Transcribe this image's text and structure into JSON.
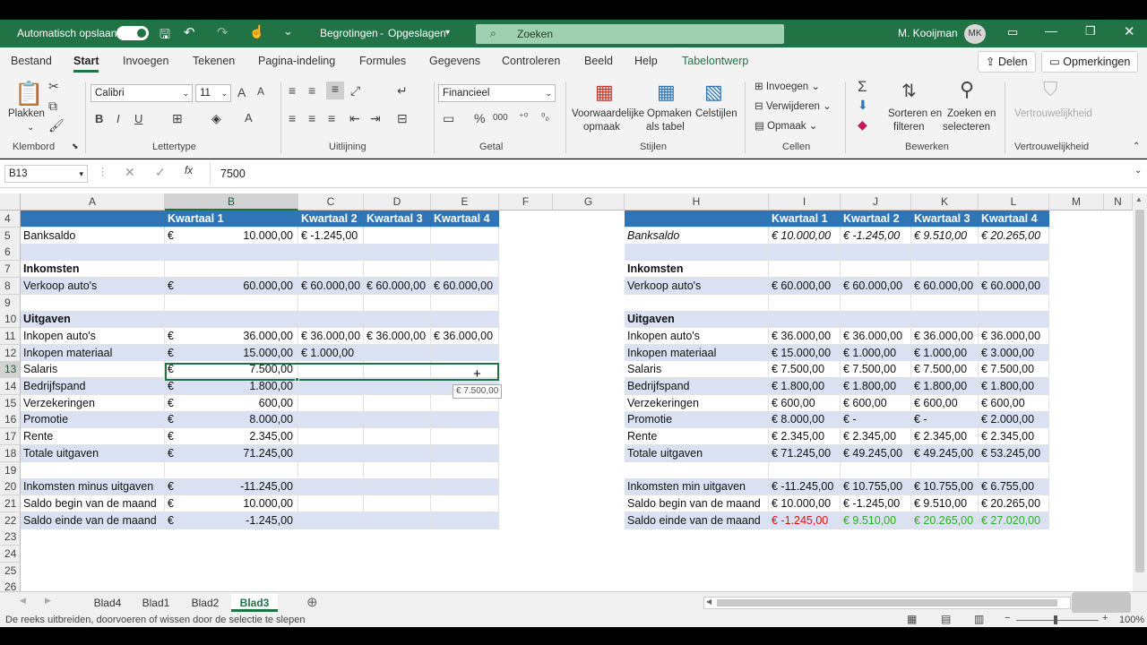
{
  "titlebar": {
    "autosave_label": "Automatisch opslaan",
    "doc_title": "Begrotingen",
    "doc_status": "Opgeslagen",
    "search_placeholder": "Zoeken",
    "user_name": "M. Kooijman",
    "user_initials": "MK"
  },
  "ribbon_tabs": [
    "Bestand",
    "Start",
    "Invoegen",
    "Tekenen",
    "Pagina-indeling",
    "Formules",
    "Gegevens",
    "Controleren",
    "Beeld",
    "Help",
    "Tabelontwerp"
  ],
  "share_label": "Delen",
  "comments_label": "Opmerkingen",
  "ribbon": {
    "paste": "Plakken",
    "clipboard": "Klembord",
    "font_name": "Calibri",
    "font_size": "11",
    "font_group": "Lettertype",
    "align_group": "Uitlijning",
    "number_format": "Financieel",
    "number_group": "Getal",
    "cond_fmt_1": "Voorwaardelijke",
    "cond_fmt_2": "opmaak",
    "fmt_table_1": "Opmaken",
    "fmt_table_2": "als tabel",
    "cell_styles": "Celstijlen",
    "styles_group": "Stijlen",
    "insert": "Invoegen",
    "delete": "Verwijderen",
    "format": "Opmaak",
    "cells_group": "Cellen",
    "sort_1": "Sorteren en",
    "sort_2": "filteren",
    "find_1": "Zoeken en",
    "find_2": "selecteren",
    "edit_group": "Bewerken",
    "sens": "Vertrouwelijkheid",
    "sens_group": "Vertrouwelijkheid"
  },
  "formula_bar": {
    "name_box": "B13",
    "fx": "fx",
    "value": "7500"
  },
  "columns": [
    "A",
    "B",
    "C",
    "D",
    "E",
    "F",
    "G",
    "H",
    "I",
    "J",
    "K",
    "L",
    "M",
    "N"
  ],
  "rows": [
    "4",
    "5",
    "6",
    "7",
    "8",
    "9",
    "10",
    "11",
    "12",
    "13",
    "14",
    "15",
    "16",
    "17",
    "18",
    "19",
    "20",
    "21",
    "22",
    "23",
    "24",
    "25",
    "26"
  ],
  "left": {
    "headers": [
      "Kwartaal 1",
      "Kwartaal 2",
      "Kwartaal 3",
      "Kwartaal 4"
    ],
    "banksaldo": {
      "label": "Banksaldo",
      "b": "10.000,00",
      "c": "€ -1.245,00"
    },
    "inkomsten": "Inkomsten",
    "verkoop": {
      "label": "Verkoop auto's",
      "b": "60.000,00",
      "c": "€ 60.000,00",
      "d": "€ 60.000,00",
      "e": "€ 60.000,00"
    },
    "uitgaven": "Uitgaven",
    "items": [
      {
        "label": "Inkopen auto's",
        "b": "36.000,00",
        "c": "€ 36.000,00",
        "d": "€ 36.000,00",
        "e": "€ 36.000,00"
      },
      {
        "label": "Inkopen materiaal",
        "b": "15.000,00",
        "c": "€  1.000,00",
        "d": "",
        "e": ""
      },
      {
        "label": "Salaris",
        "b": "7.500,00",
        "c": "",
        "d": "",
        "e": ""
      },
      {
        "label": "Bedrijfspand",
        "b": "1.800,00",
        "c": "",
        "d": "",
        "e": ""
      },
      {
        "label": "Verzekeringen",
        "b": "600,00",
        "c": "",
        "d": "",
        "e": ""
      },
      {
        "label": "Promotie",
        "b": "8.000,00",
        "c": "",
        "d": "",
        "e": ""
      },
      {
        "label": "Rente",
        "b": "2.345,00",
        "c": "",
        "d": "",
        "e": ""
      },
      {
        "label": "Totale uitgaven",
        "b": "71.245,00",
        "c": "",
        "d": "",
        "e": ""
      }
    ],
    "summary": [
      {
        "label": "Inkomsten minus uitgaven",
        "b": "-11.245,00"
      },
      {
        "label": "Saldo begin van de maand",
        "b": "10.000,00"
      },
      {
        "label": "Saldo einde van de maand",
        "b": "-1.245,00"
      }
    ],
    "euro": "€",
    "tooltip": "€ 7.500,00"
  },
  "right": {
    "headers": [
      "Kwartaal 1",
      "Kwartaal 2",
      "Kwartaal 3",
      "Kwartaal 4"
    ],
    "banksaldo": {
      "label": "Banksaldo",
      "v": [
        "€  10.000,00",
        "€  -1.245,00",
        "€  9.510,00",
        "€  20.265,00"
      ]
    },
    "inkomsten": "Inkomsten",
    "verkoop": {
      "label": "Verkoop auto's",
      "v": [
        "€  60.000,00",
        "€  60.000,00",
        "€ 60.000,00",
        "€  60.000,00"
      ]
    },
    "uitgaven": "Uitgaven",
    "items": [
      {
        "label": "Inkopen auto's",
        "v": [
          "€  36.000,00",
          "€  36.000,00",
          "€ 36.000,00",
          "€  36.000,00"
        ]
      },
      {
        "label": "Inkopen materiaal",
        "v": [
          "€  15.000,00",
          "€     1.000,00",
          "€  1.000,00",
          "€    3.000,00"
        ]
      },
      {
        "label": "Salaris",
        "v": [
          "€    7.500,00",
          "€     7.500,00",
          "€  7.500,00",
          "€    7.500,00"
        ]
      },
      {
        "label": "Bedrijfspand",
        "v": [
          "€    1.800,00",
          "€     1.800,00",
          "€  1.800,00",
          "€    1.800,00"
        ]
      },
      {
        "label": "Verzekeringen",
        "v": [
          "€       600,00",
          "€        600,00",
          "€     600,00",
          "€       600,00"
        ]
      },
      {
        "label": "Promotie",
        "v": [
          "€    8.000,00",
          "€              -",
          "€          -",
          "€    2.000,00"
        ]
      },
      {
        "label": "Rente",
        "v": [
          "€    2.345,00",
          "€     2.345,00",
          "€  2.345,00",
          "€    2.345,00"
        ]
      },
      {
        "label": "Totale uitgaven",
        "v": [
          "€  71.245,00",
          "€  49.245,00",
          "€ 49.245,00",
          "€  53.245,00"
        ]
      }
    ],
    "summary": [
      {
        "label": "Inkomsten min uitgaven",
        "v": [
          "€ -11.245,00",
          "€  10.755,00",
          "€ 10.755,00",
          "€    6.755,00"
        ]
      },
      {
        "label": "Saldo begin van de maand",
        "v": [
          "€  10.000,00",
          "€  -1.245,00",
          "€  9.510,00",
          "€  20.265,00"
        ]
      },
      {
        "label": "Saldo einde van de maand",
        "v": [
          "€   -1.245,00",
          "€     9.510,00",
          "€ 20.265,00",
          "€  27.020,00"
        ]
      }
    ]
  },
  "sheets": [
    "Blad4",
    "Blad1",
    "Blad2",
    "Blad3"
  ],
  "active_sheet": "Blad3",
  "status_text": "De reeks uitbreiden, doorvoeren of wissen door de selectie te slepen",
  "zoom": "100%",
  "colors": {
    "excel_green": "#217346",
    "header_blue": "#2f75b5",
    "band": "#d9e1f2",
    "negative": "#e01010",
    "positive": "#2bb01f"
  }
}
